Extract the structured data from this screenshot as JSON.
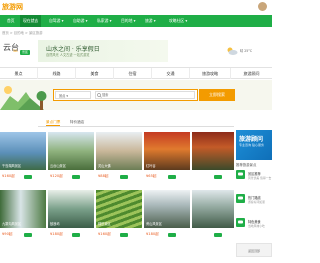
{
  "header": {
    "logo": "旅游网",
    "avatar_icon": "user-avatar"
  },
  "nav": {
    "items": [
      {
        "label": "首页"
      },
      {
        "label": "现在就去",
        "active": true
      },
      {
        "label": "自驾游 ▾"
      },
      {
        "label": "自助游 ▾"
      },
      {
        "label": "私家游 ▾"
      },
      {
        "label": "目的地 ▾"
      },
      {
        "label": "旅游 ▾"
      },
      {
        "label": "攻略社区 ▾"
      }
    ]
  },
  "breadcrumb": "首页  >  目的地  >  景区旅游",
  "city": {
    "title": "云台",
    "star_label": "5A",
    "badge": "景区"
  },
  "ad": {
    "title": "山水之间 · 乐享假日",
    "subtitle": "自然风光 人文古迹 一站式游览"
  },
  "weather": {
    "text": "晴 25°C"
  },
  "tabs": [
    "景点",
    "线路",
    "美食",
    "住宿",
    "交通",
    "旅游攻略",
    "旅游顾问"
  ],
  "search": {
    "select_value": "景点 ▾",
    "placeholder": "搜索",
    "button": "立即搜索"
  },
  "subtabs": {
    "items": [
      "景点门票",
      "特价酒店"
    ]
  },
  "colors": {
    "brand": "#1fae47",
    "accent": "#f39b00",
    "price": "#e85b1f"
  },
  "cards": [
    {
      "name": "千岛湖风景区",
      "price": "¥160起"
    },
    {
      "name": "云台山景区",
      "price": "¥120起"
    },
    {
      "name": "灵山大佛",
      "price": "¥88起"
    },
    {
      "name": "红叶谷",
      "price": "¥65起"
    },
    {
      "name": "九寨沟风景区",
      "price": "¥90起"
    },
    {
      "name": "鼓浪屿",
      "price": "¥180起"
    },
    {
      "name": "梯田景区",
      "price": "¥160起"
    },
    {
      "name": "黄山风景区",
      "price": "¥180起"
    }
  ],
  "side": {
    "banner_title": "旅游顾问",
    "banner_sub": "专业咨询 贴心服务",
    "rec_title": "推荐旅游景点",
    "recs": [
      {
        "title": "景区推荐",
        "comment": "风景优美 值得一去"
      },
      {
        "title": "热门路线",
        "comment": "游客好评如潮"
      },
      {
        "title": "特色美食",
        "comment": "当地风味小吃"
      }
    ],
    "gototop": "返回顶部"
  }
}
